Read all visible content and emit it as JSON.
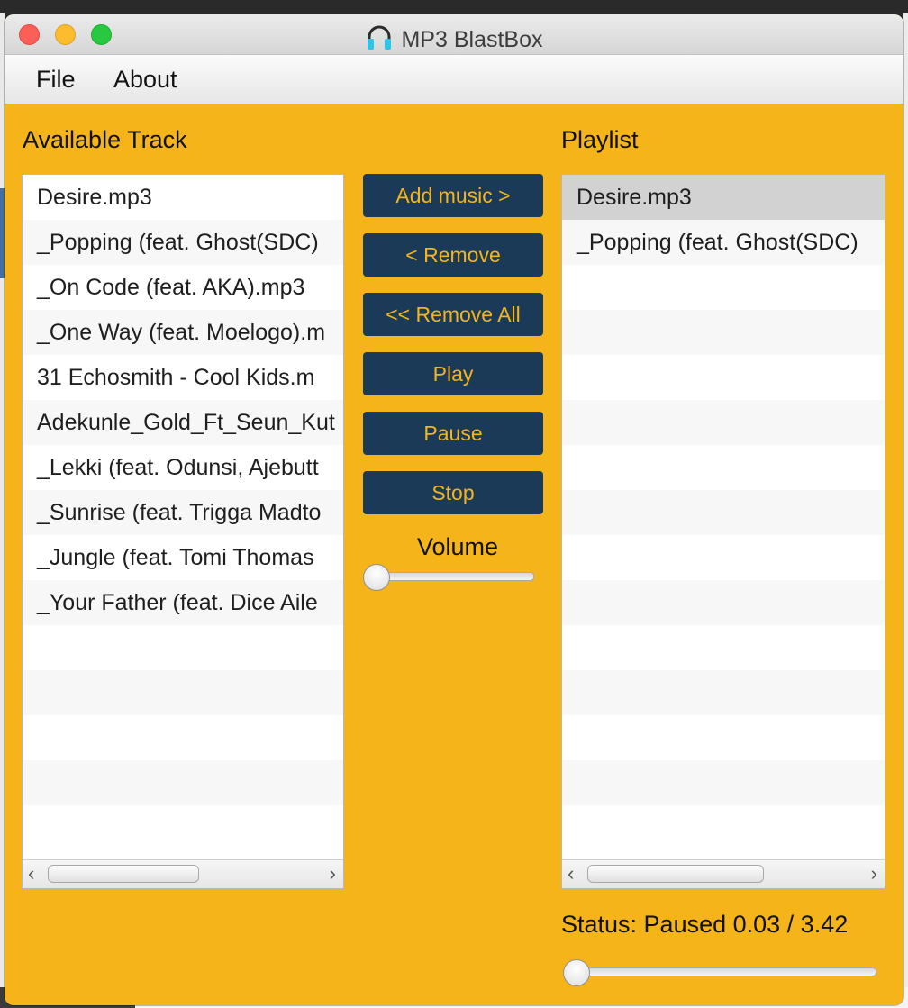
{
  "window": {
    "title": "MP3 BlastBox",
    "title_icon": "headphones-icon"
  },
  "menu": {
    "file": "File",
    "about": "About"
  },
  "available": {
    "label": "Available Track",
    "tracks": [
      "Desire.mp3",
      "_Popping (feat. Ghost(SDC)",
      "_On Code (feat. AKA).mp3",
      "_One Way (feat. Moelogo).m",
      "31 Echosmith - Cool Kids.m",
      "Adekunle_Gold_Ft_Seun_Kut",
      "_Lekki (feat. Odunsi, Ajebutt",
      "_Sunrise (feat. Trigga Madto",
      "_Jungle (feat. Tomi Thomas",
      "_Your Father (feat. Dice Aile"
    ]
  },
  "buttons": {
    "add": "Add music >",
    "remove": "< Remove",
    "remove_all": "<< Remove All",
    "play": "Play",
    "pause": "Pause",
    "stop": "Stop"
  },
  "volume": {
    "label": "Volume",
    "level": 0.0
  },
  "playlist": {
    "label": "Playlist",
    "tracks": [
      "Desire.mp3",
      "_Popping (feat. Ghost(SDC)"
    ],
    "selected_index": 0
  },
  "status": {
    "text": "Status: Paused 0.03 / 3.42",
    "progress": 0.0
  },
  "colors": {
    "background": "#f4b41a",
    "button_bg": "#1b3a57",
    "button_text": "#f4b41a"
  }
}
